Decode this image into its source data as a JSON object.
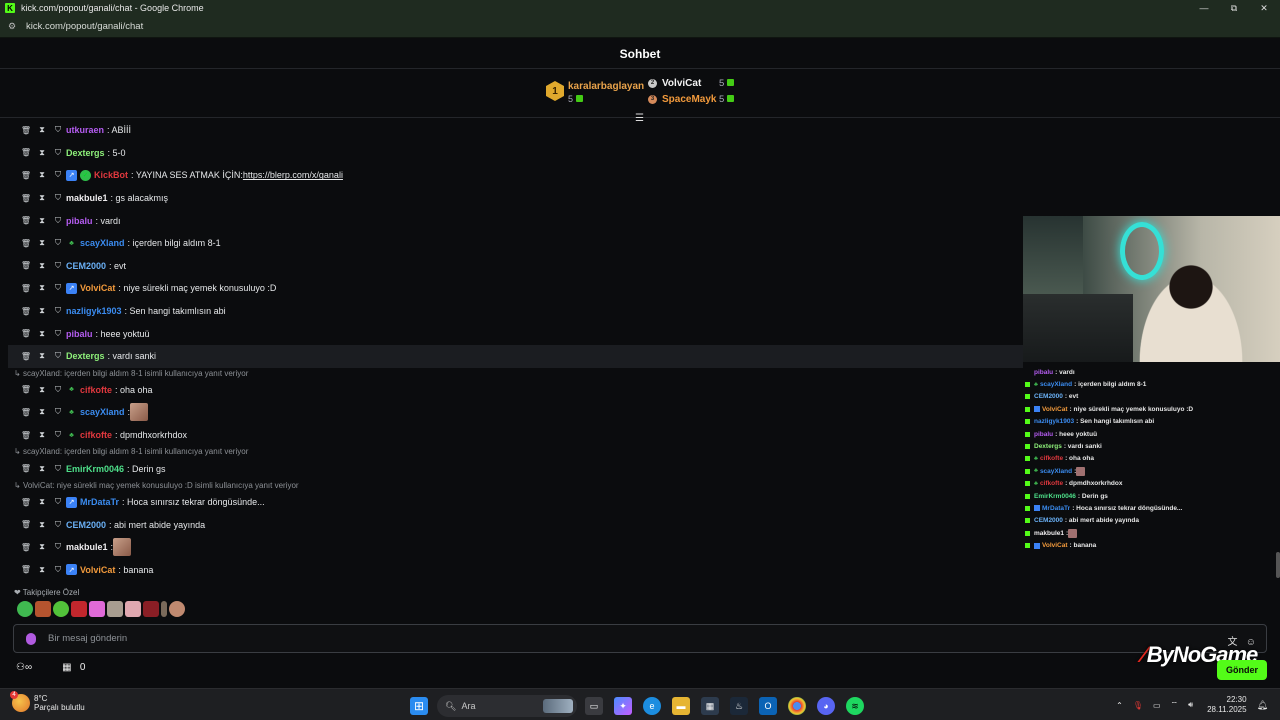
{
  "browser": {
    "window_title": "kick.com/popout/ganali/chat - Google Chrome",
    "url": "kick.com/popout/ganali/chat",
    "minimize": "—",
    "restore": "⧉",
    "close": "✕"
  },
  "chat": {
    "title": "Sohbet",
    "leaderboard": {
      "first": {
        "rank": "1",
        "name": "karalarbaglayan",
        "count": "5"
      },
      "second": {
        "name": "VolviCat",
        "count": "5"
      },
      "third": {
        "name": "SpaceMayk",
        "count": "5"
      }
    },
    "messages": [
      {
        "user": "utkuraen",
        "color": "#b45cf0",
        "text": ": ABİİİ",
        "badges": []
      },
      {
        "user": "Dextergs",
        "color": "#8ef07a",
        "text": ": 5-0",
        "badges": []
      },
      {
        "user": "KickBot",
        "color": "#e0383e",
        "text": ": YAYINA SES ATMAK İÇİN: ",
        "link": "https://blerp.com/x/ganali",
        "badges": [
          "blue",
          "green"
        ]
      },
      {
        "user": "makbule1",
        "color": "#f0eef0",
        "text": ": gs alacakmış",
        "badges": []
      },
      {
        "user": "pibalu",
        "color": "#b45cf0",
        "text": ": vardı",
        "badges": []
      },
      {
        "user": "scayXland",
        "color": "#3b8cf0",
        "text": ": içerden bilgi aldım 8-1",
        "badges": [
          "leaf"
        ]
      },
      {
        "user": "CEM2000",
        "color": "#6ab0f5",
        "text": ": evt",
        "badges": []
      },
      {
        "user": "VolviCat",
        "color": "#f29a3c",
        "text": ": niye sürekli maç yemek konusuluyo :D",
        "badges": [
          "blue"
        ]
      },
      {
        "user": "nazligyk1903",
        "color": "#3b8cf0",
        "text": ": Sen hangi takımlısın abi",
        "badges": []
      },
      {
        "user": "pibalu",
        "color": "#b45cf0",
        "text": ": heee yoktuü",
        "badges": []
      },
      {
        "user": "Dextergs",
        "color": "#8ef07a",
        "text": ": vardı sanki",
        "badges": [],
        "highlight": true
      },
      {
        "reply": "scayXland: içerden bilgi aldım 8-1 isimli kullanıcıya yanıt veriyor"
      },
      {
        "user": "cifkofte",
        "color": "#e0383e",
        "text": ": oha oha",
        "badges": [
          "leaf"
        ]
      },
      {
        "user": "scayXland",
        "color": "#3b8cf0",
        "text": ": ",
        "badges": [
          "leaf"
        ],
        "emote": true
      },
      {
        "user": "cifkofte",
        "color": "#e0383e",
        "text": ": dpmdhxorkrhdox",
        "badges": [
          "leaf"
        ]
      },
      {
        "reply": "scayXland: içerden bilgi aldım 8-1 isimli kullanıcıya yanıt veriyor"
      },
      {
        "user": "EmirKrm0046",
        "color": "#4ee08a",
        "text": ": Derin gs",
        "badges": []
      },
      {
        "reply": "VolviCat: niye sürekli maç yemek konusuluyo :D isimli kullanıcıya yanıt veriyor"
      },
      {
        "user": "MrDataTr",
        "color": "#3b8cf0",
        "text": ": Hoca sınırsız tekrar döngüsünde...",
        "badges": [
          "blue"
        ]
      },
      {
        "user": "CEM2000",
        "color": "#6ab0f5",
        "text": ": abi mert abide yayında",
        "badges": []
      },
      {
        "user": "makbule1",
        "color": "#f0eef0",
        "text": ": ",
        "badges": [],
        "emote": true
      },
      {
        "user": "VolviCat",
        "color": "#f29a3c",
        "text": ": banana",
        "badges": [
          "blue"
        ]
      }
    ],
    "followers_label": "Takipçilere Özel",
    "input_placeholder": "Bir mesaj gönderin",
    "infinity": "∞",
    "gift_count": "0",
    "send_label": "Gönder"
  },
  "overlay": {
    "watermark": "ByNoGame",
    "lines": [
      {
        "user": "pibalu",
        "color": "#b45cf0",
        "text": ": vardı",
        "k": false
      },
      {
        "user": "scayXland",
        "color": "#3b8cf0",
        "text": ": içerden bilgi aldım 8-1",
        "k": true,
        "leaf": true
      },
      {
        "user": "CEM2000",
        "color": "#6ab0f5",
        "text": ": evt",
        "k": true
      },
      {
        "user": "VolviCat",
        "color": "#f29a3c",
        "text": ": niye sürekli maç yemek konusuluyo :D",
        "k": true,
        "blue": true
      },
      {
        "user": "nazligyk1903",
        "color": "#3b8cf0",
        "text": ": Sen hangi takımlısın abi",
        "k": true
      },
      {
        "user": "pibalu",
        "color": "#b45cf0",
        "text": ": heee yoktuü",
        "k": true
      },
      {
        "user": "Dextergs",
        "color": "#8ef07a",
        "text": ": vardı sanki",
        "k": true
      },
      {
        "user": "cifkofte",
        "color": "#e0383e",
        "text": ": oha oha",
        "k": true,
        "leaf": true
      },
      {
        "user": "scayXland",
        "color": "#3b8cf0",
        "text": ": ",
        "k": true,
        "leaf": true,
        "emote": true
      },
      {
        "user": "cifkofte",
        "color": "#e0383e",
        "text": ": dpmdhxorkrhdox",
        "k": true,
        "leaf": true
      },
      {
        "user": "EmirKrm0046",
        "color": "#4ee08a",
        "text": ": Derin gs",
        "k": true
      },
      {
        "user": "MrDataTr",
        "color": "#3b8cf0",
        "text": ": Hoca sınırsız tekrar döngüsünde...",
        "k": true,
        "blue": true
      },
      {
        "user": "CEM2000",
        "color": "#6ab0f5",
        "text": ": abi mert abide yayında",
        "k": true
      },
      {
        "user": "makbule1",
        "color": "#f0eef0",
        "text": ": ",
        "k": true,
        "emote": true
      },
      {
        "user": "VolviCat",
        "color": "#f29a3c",
        "text": ": banana",
        "k": true,
        "blue": true
      }
    ]
  },
  "taskbar": {
    "temperature": "8°C",
    "weather": "Parçalı bulutlu",
    "weather_badge": "4",
    "search_label": "Ara",
    "time": "22:30",
    "date": "28.11.2025"
  },
  "icons": {
    "trash": "🗑",
    "timeout": "⧗",
    "shield": "⛉"
  },
  "colors": {
    "kick_green": "#53fc18",
    "accent_purple": "#b15be0"
  }
}
